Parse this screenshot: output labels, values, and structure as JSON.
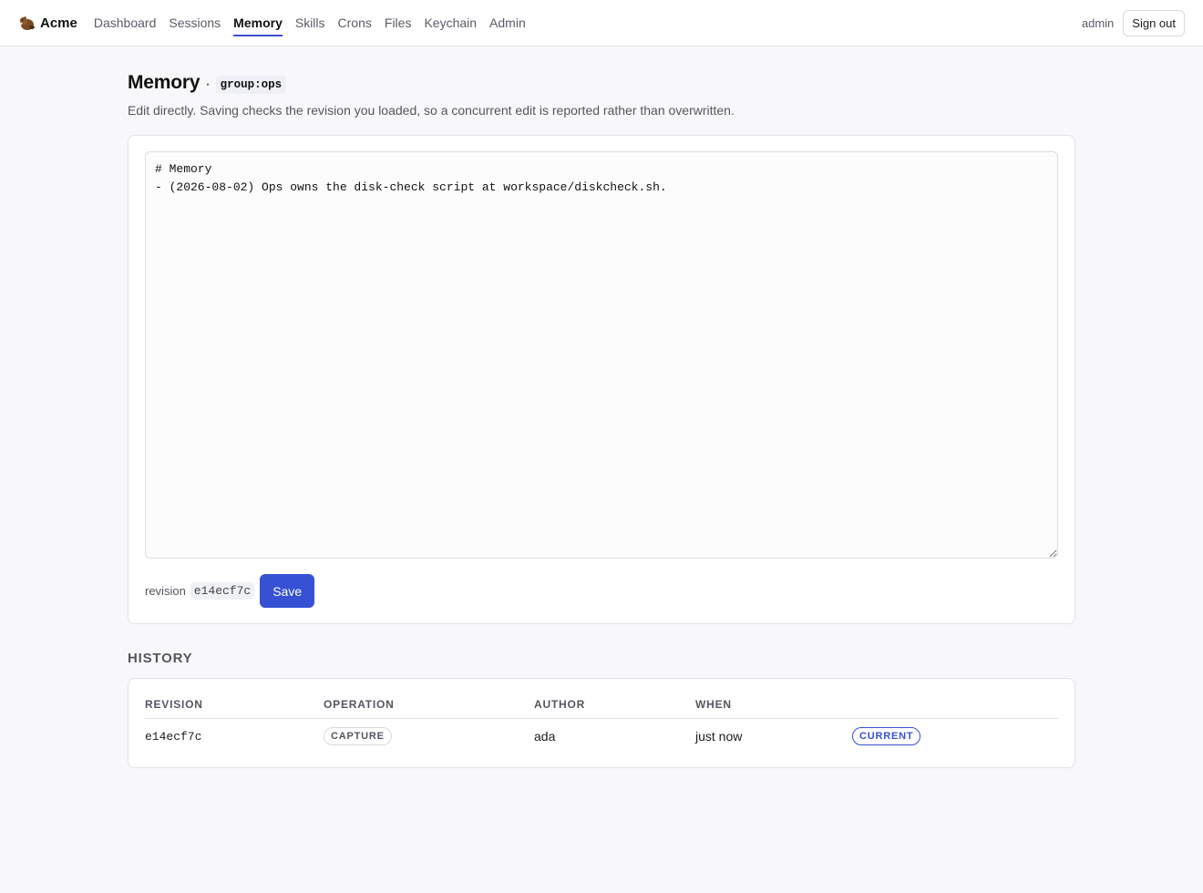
{
  "app": {
    "brand": "Acme",
    "logo_icon": "beaver-icon"
  },
  "nav": {
    "items": [
      {
        "label": "Dashboard",
        "active": false
      },
      {
        "label": "Sessions",
        "active": false
      },
      {
        "label": "Memory",
        "active": true
      },
      {
        "label": "Skills",
        "active": false
      },
      {
        "label": "Crons",
        "active": false
      },
      {
        "label": "Files",
        "active": false
      },
      {
        "label": "Keychain",
        "active": false
      },
      {
        "label": "Admin",
        "active": false
      }
    ],
    "user": "admin",
    "signout_label": "Sign out"
  },
  "page": {
    "title": "Memory",
    "separator": "·",
    "scope": "group:ops",
    "subtitle": "Edit directly. Saving checks the revision you loaded, so a concurrent edit is reported rather than overwritten."
  },
  "editor": {
    "content": "# Memory\n- (2026-08-02) Ops owns the disk-check script at workspace/diskcheck.sh.",
    "revision_label": "revision",
    "revision_value": "e14ecf7c",
    "save_label": "Save"
  },
  "history": {
    "title": "HISTORY",
    "columns": [
      "REVISION",
      "OPERATION",
      "AUTHOR",
      "WHEN"
    ],
    "rows": [
      {
        "revision": "e14ecf7c",
        "operation": "CAPTURE",
        "author": "ada",
        "when": "just now",
        "status": "CURRENT"
      }
    ]
  },
  "colors": {
    "accent": "#3651d4",
    "page_bg": "#f8f8fa",
    "card_bg": "#ffffff"
  }
}
